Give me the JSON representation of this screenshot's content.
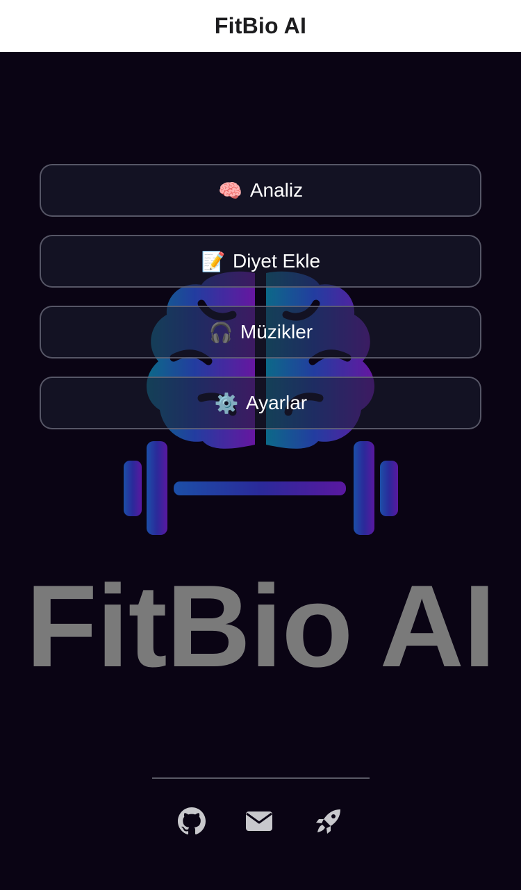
{
  "header": {
    "title": "FitBio AI"
  },
  "logo": {
    "wordmark": "FitBio AI",
    "brain_icon": "brain-icon",
    "dumbbell_icon": "dumbbell-icon"
  },
  "menu": {
    "items": [
      {
        "emoji": "🧠",
        "label": "Analiz",
        "icon": "brain-emoji-icon"
      },
      {
        "emoji": "📝",
        "label": "Diyet Ekle",
        "icon": "memo-emoji-icon"
      },
      {
        "emoji": "🎧",
        "label": "Müzikler",
        "icon": "headphones-emoji-icon"
      },
      {
        "emoji": "⚙️",
        "label": "Ayarlar",
        "icon": "gear-emoji-icon"
      }
    ]
  },
  "footer": {
    "icons": [
      "github-icon",
      "mail-icon",
      "rocket-icon"
    ]
  },
  "colors": {
    "background": "#0a0414",
    "button_border": "#6e6e7d",
    "button_fill": "#1c1f30",
    "wordmark": "#7a7a7a",
    "brand_blue": "#1e4fa8",
    "brand_purple": "#6a1aa8"
  }
}
